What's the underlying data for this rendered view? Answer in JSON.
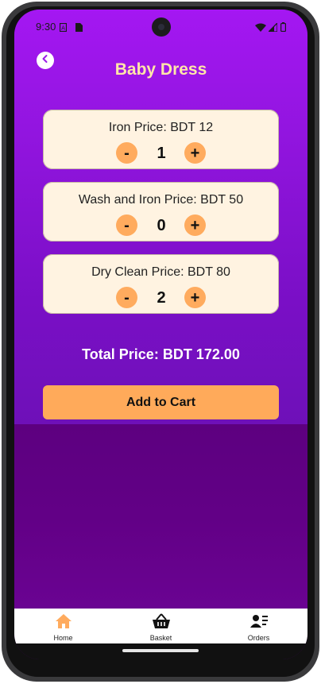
{
  "status_bar": {
    "time": "9:30"
  },
  "header": {
    "title": "Baby Dress"
  },
  "services": [
    {
      "label": "Iron Price: BDT 12",
      "quantity": "1",
      "minus": "-",
      "plus": "+"
    },
    {
      "label": "Wash and Iron Price: BDT 50",
      "quantity": "0",
      "minus": "-",
      "plus": "+"
    },
    {
      "label": "Dry Clean Price: BDT 80",
      "quantity": "2",
      "minus": "-",
      "plus": "+"
    }
  ],
  "total": {
    "text": "Total Price: BDT 172.00"
  },
  "actions": {
    "add_to_cart": "Add to Cart"
  },
  "bottom_nav": {
    "items": [
      {
        "label": "Home",
        "icon": "home-icon",
        "active": true
      },
      {
        "label": "Basket",
        "icon": "basket-icon",
        "active": false
      },
      {
        "label": "Orders",
        "icon": "orders-icon",
        "active": false
      }
    ]
  },
  "colors": {
    "accent": "#ffab5e",
    "title": "#ffe6a8",
    "card": "#fff3e1",
    "gradient_top": "#a417f2",
    "background": "#5d0080"
  }
}
